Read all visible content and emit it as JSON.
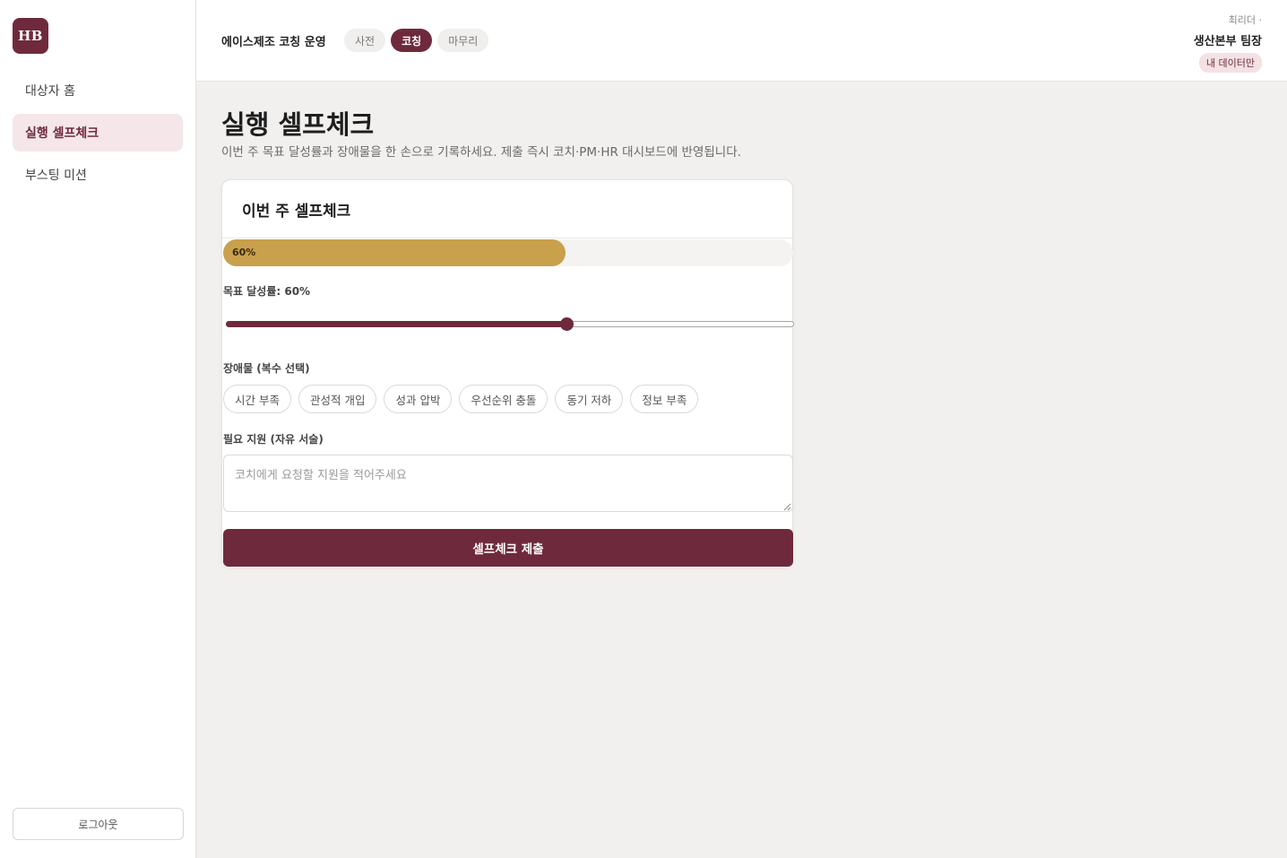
{
  "app": {
    "logo_text": "HB"
  },
  "sidebar": {
    "items": [
      {
        "label": "대상자 홈"
      },
      {
        "label": "실행 셀프체크"
      },
      {
        "label": "부스팅 미션"
      }
    ],
    "logout_label": "로그아웃"
  },
  "header": {
    "org_name": "에이스제조 코칭 운영",
    "phases": [
      {
        "label": "사전"
      },
      {
        "label": "코칭"
      },
      {
        "label": "마무리"
      }
    ],
    "active_phase": "코칭",
    "user_role": "최리더 ·",
    "user_name": "생산본부 팀장",
    "user_badge": "내 데이터만"
  },
  "main": {
    "title": "실행 셀프체크",
    "subtitle": "이번 주 목표 달성률과 장애물을 한 손으로 기록하세요. 제출 즉시 코치·PM·HR 대시보드에 반영됩니다.",
    "card": {
      "title": "이번 주 셀프체크",
      "progress_value": 0.6,
      "progress_label": "60%",
      "goal_label": "목표 달성률: 60%",
      "slider_value": 0.6,
      "obstacles_label": "장애물 (복수 선택)",
      "obstacles": [
        {
          "label": "시간 부족"
        },
        {
          "label": "관성적 개입"
        },
        {
          "label": "성과 압박"
        },
        {
          "label": "우선순위 충돌"
        },
        {
          "label": "동기 저하"
        },
        {
          "label": "정보 부족"
        }
      ],
      "support_label": "필요 지원 (자유 서술)",
      "support_placeholder": "코치에게 요청할 지원을 적어주세요",
      "submit_label": "셀프체크 제출"
    }
  },
  "colors": {
    "accent": "#6e2a3c",
    "progress": "#c9a04b",
    "background": "#f1f0ee"
  }
}
